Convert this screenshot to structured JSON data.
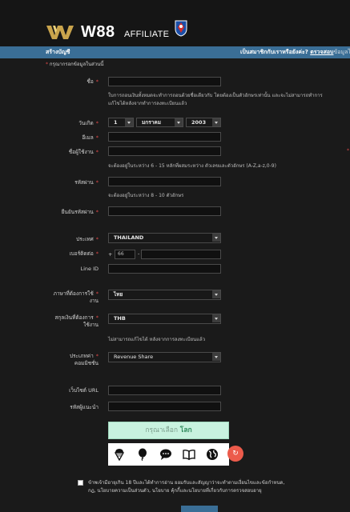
{
  "header": {
    "logo_text": "W88",
    "logo_sub": "AFFILIATE"
  },
  "bar": {
    "title": "สร้างบัญชี",
    "right_text": "เป็นสมาชิกกับเราหรือยังค่ะ?",
    "check_link": "ตรวจสอบ",
    "login_link": "ข้อมูลไว้ที่"
  },
  "required_note": "กรุณากรอกข้อมูลในส่วนนี้",
  "form": {
    "name_label": "ชื่อ",
    "name_note_1": "ใบการถอนเงินทั้งหมดจะทำการถอนด้วยชื่อเดียวกับ โดยต้องเป็นตัวอักษรเท่านั้น และจะไม่สามารถทำการ",
    "name_note_2": "แก้ไขได้หลังจากทำการลงทะเบียนแล้ว",
    "dob_label": "วันเกิด",
    "dob_day": "1",
    "dob_month": "มกราคม",
    "dob_year": "2003",
    "email_label": "อีเมล",
    "username_label": "ชื่อผู้ใช้งาน",
    "username_note": "จะต้องอยู่ในระหว่าง 6 - 15 หลักที่ผสมระหว่าง ตัวเลขและตัวอักษร (A-Z,a-z,0-9)",
    "password_label": "รหัสผ่าน",
    "password_note": "จะต้องอยู่ในระหว่าง 8 - 10 ตัวอักษร",
    "confirm_label": "ยืนยันรหัสผ่าน",
    "country_label": "ประเทศ",
    "country_value": "THAILAND",
    "phone_label": "เบอร์ติดต่อ",
    "phone_plus": "+",
    "phone_code": "66",
    "phone_dash": "-",
    "line_label": "Line ID",
    "language_label_1": "ภาษาที่ต้องการใช้",
    "language_label_2": "งาน",
    "language_value": "ไทย",
    "currency_label_1": "สกุลเงินที่ต้องการ",
    "currency_label_2": "ใช้งาน",
    "currency_value": "THB",
    "currency_note": "ไม่สามารถแก้ไขได้ หลังจากการลงทะเบียนแล้ว",
    "commission_label_1": "ประเภทค่า",
    "commission_label_2": "คอมมิชชั่น",
    "commission_value": "Revenue Share",
    "website_label": "เว็บไซต์ URL",
    "referral_label": "รหัสผู้แนะนำ"
  },
  "captcha": {
    "prompt_prefix": "กรุณาเลือก",
    "prompt_target": "โลก",
    "icons": [
      "ice-cream-icon",
      "balloon-icon",
      "speech-bubble-icon",
      "book-icon",
      "globe-icon"
    ],
    "refresh_icon": "refresh-icon"
  },
  "agreement": {
    "line_1": "ข้าพเจ้ามีอายุเกิน 18 ปีและได้ทำการอ่าน ยอมรับและสัญญาว่าจะทำตามเงื่อนไขและข้อกำหนด,",
    "line_2": "กฎ, นโยบายความเป็นส่วนตัว, นโยบาย คุ้กกี้และนโยบายที่เกี่ยวกับการตรวจสอบอายุ"
  },
  "colors": {
    "bar": "#3a6e96",
    "required_star": "#e04848",
    "captcha_bg": "#c8f2df",
    "refresh": "#ec5b4b"
  }
}
